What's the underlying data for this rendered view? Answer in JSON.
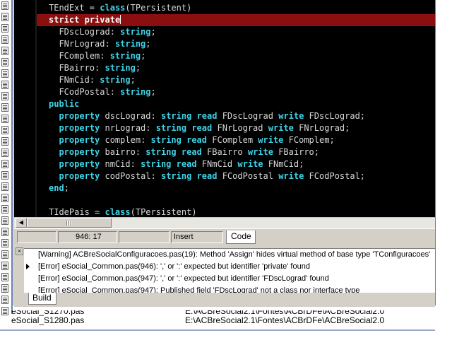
{
  "editor": {
    "code_lines": [
      "TEndExt = class(TPersistent)",
      "strict private",
      "  FDscLograd: string;",
      "  FNrLograd: string;",
      "  FComplem: string;",
      "  FBairro: string;",
      "  FNmCid: string;",
      "  FCodPostal: string;",
      "public",
      "  property dscLograd: string read FDscLograd write FDscLograd;",
      "  property nrLograd: string read FNrLograd write FNrLograd;",
      "  property complem: string read FComplem write FComplem;",
      "  property bairro: string read FBairro write FBairro;",
      "  property nmCid: string read FNmCid write FNmCid;",
      "  property codPostal: string read FCodPostal write FCodPostal;",
      "end;",
      "",
      "TIdePais = class(TPersistent)"
    ],
    "highlight_color": "#8b0f0f",
    "keyword_color": "#3fd3e8"
  },
  "status": {
    "cursor_position": "946:  17",
    "mode": "Insert",
    "tab_code": "Code"
  },
  "messages": {
    "items": [
      "[Warning] ACBreSocialConfiguracoes.pas(19): Method 'Assign' hides virtual method of base type 'TConfiguracoes'",
      "[Error] eSocial_Common.pas(946): ',' or ':' expected but identifier 'private' found",
      "[Error] eSocial_Common.pas(947): ',' or ':' expected but identifier 'FDscLograd' found",
      "[Error] eSocial_Common.pas(947): Published field 'FDscLograd' not a class nor interface type"
    ],
    "tab_build": "Build"
  },
  "files": [
    {
      "name": "eSocial_S1270.pas",
      "path": "E:\\ACBreSocial2.1\\Fontes\\ACBrDFe\\ACBreSocial2.0"
    },
    {
      "name": "eSocial_S1280.pas",
      "path": "E:\\ACBreSocial2.1\\Fontes\\ACBrDFe\\ACBreSocial2.0"
    }
  ]
}
